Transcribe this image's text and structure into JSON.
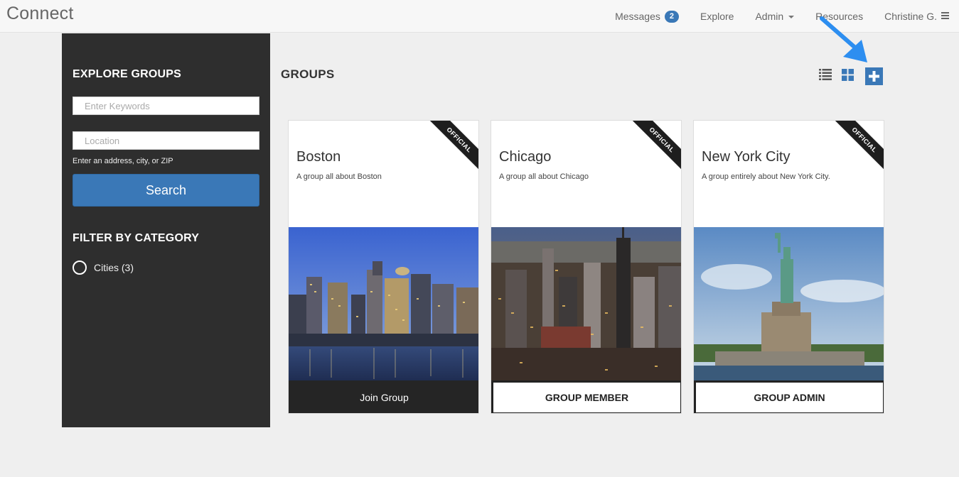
{
  "app": {
    "brand": "Connect"
  },
  "nav": {
    "messages_label": "Messages",
    "messages_count": "2",
    "explore_label": "Explore",
    "admin_label": "Admin",
    "resources_label": "Resources",
    "user_label": "Christine G."
  },
  "sidebar": {
    "title": "EXPLORE GROUPS",
    "keywords_placeholder": "Enter Keywords",
    "location_placeholder": "Location",
    "location_hint": "Enter an address, city, or ZIP",
    "search_label": "Search",
    "filter_title": "FILTER BY CATEGORY",
    "categories": [
      {
        "label": "Cities (3)"
      }
    ]
  },
  "main": {
    "title": "GROUPS",
    "icons": {
      "list_view": "list-view-icon",
      "grid_view": "grid-view-icon",
      "add": "plus-icon"
    },
    "accent_color": "#3a78b7"
  },
  "groups": [
    {
      "name": "Boston",
      "description": "A group all about Boston",
      "ribbon": "OFFICIAL",
      "action": "Join Group"
    },
    {
      "name": "Chicago",
      "description": "A group all about Chicago",
      "ribbon": "OFFICIAL",
      "action": "GROUP MEMBER"
    },
    {
      "name": "New York City",
      "description": "A group entirely about New York City.",
      "ribbon": "OFFICIAL",
      "action": "GROUP ADMIN"
    }
  ]
}
